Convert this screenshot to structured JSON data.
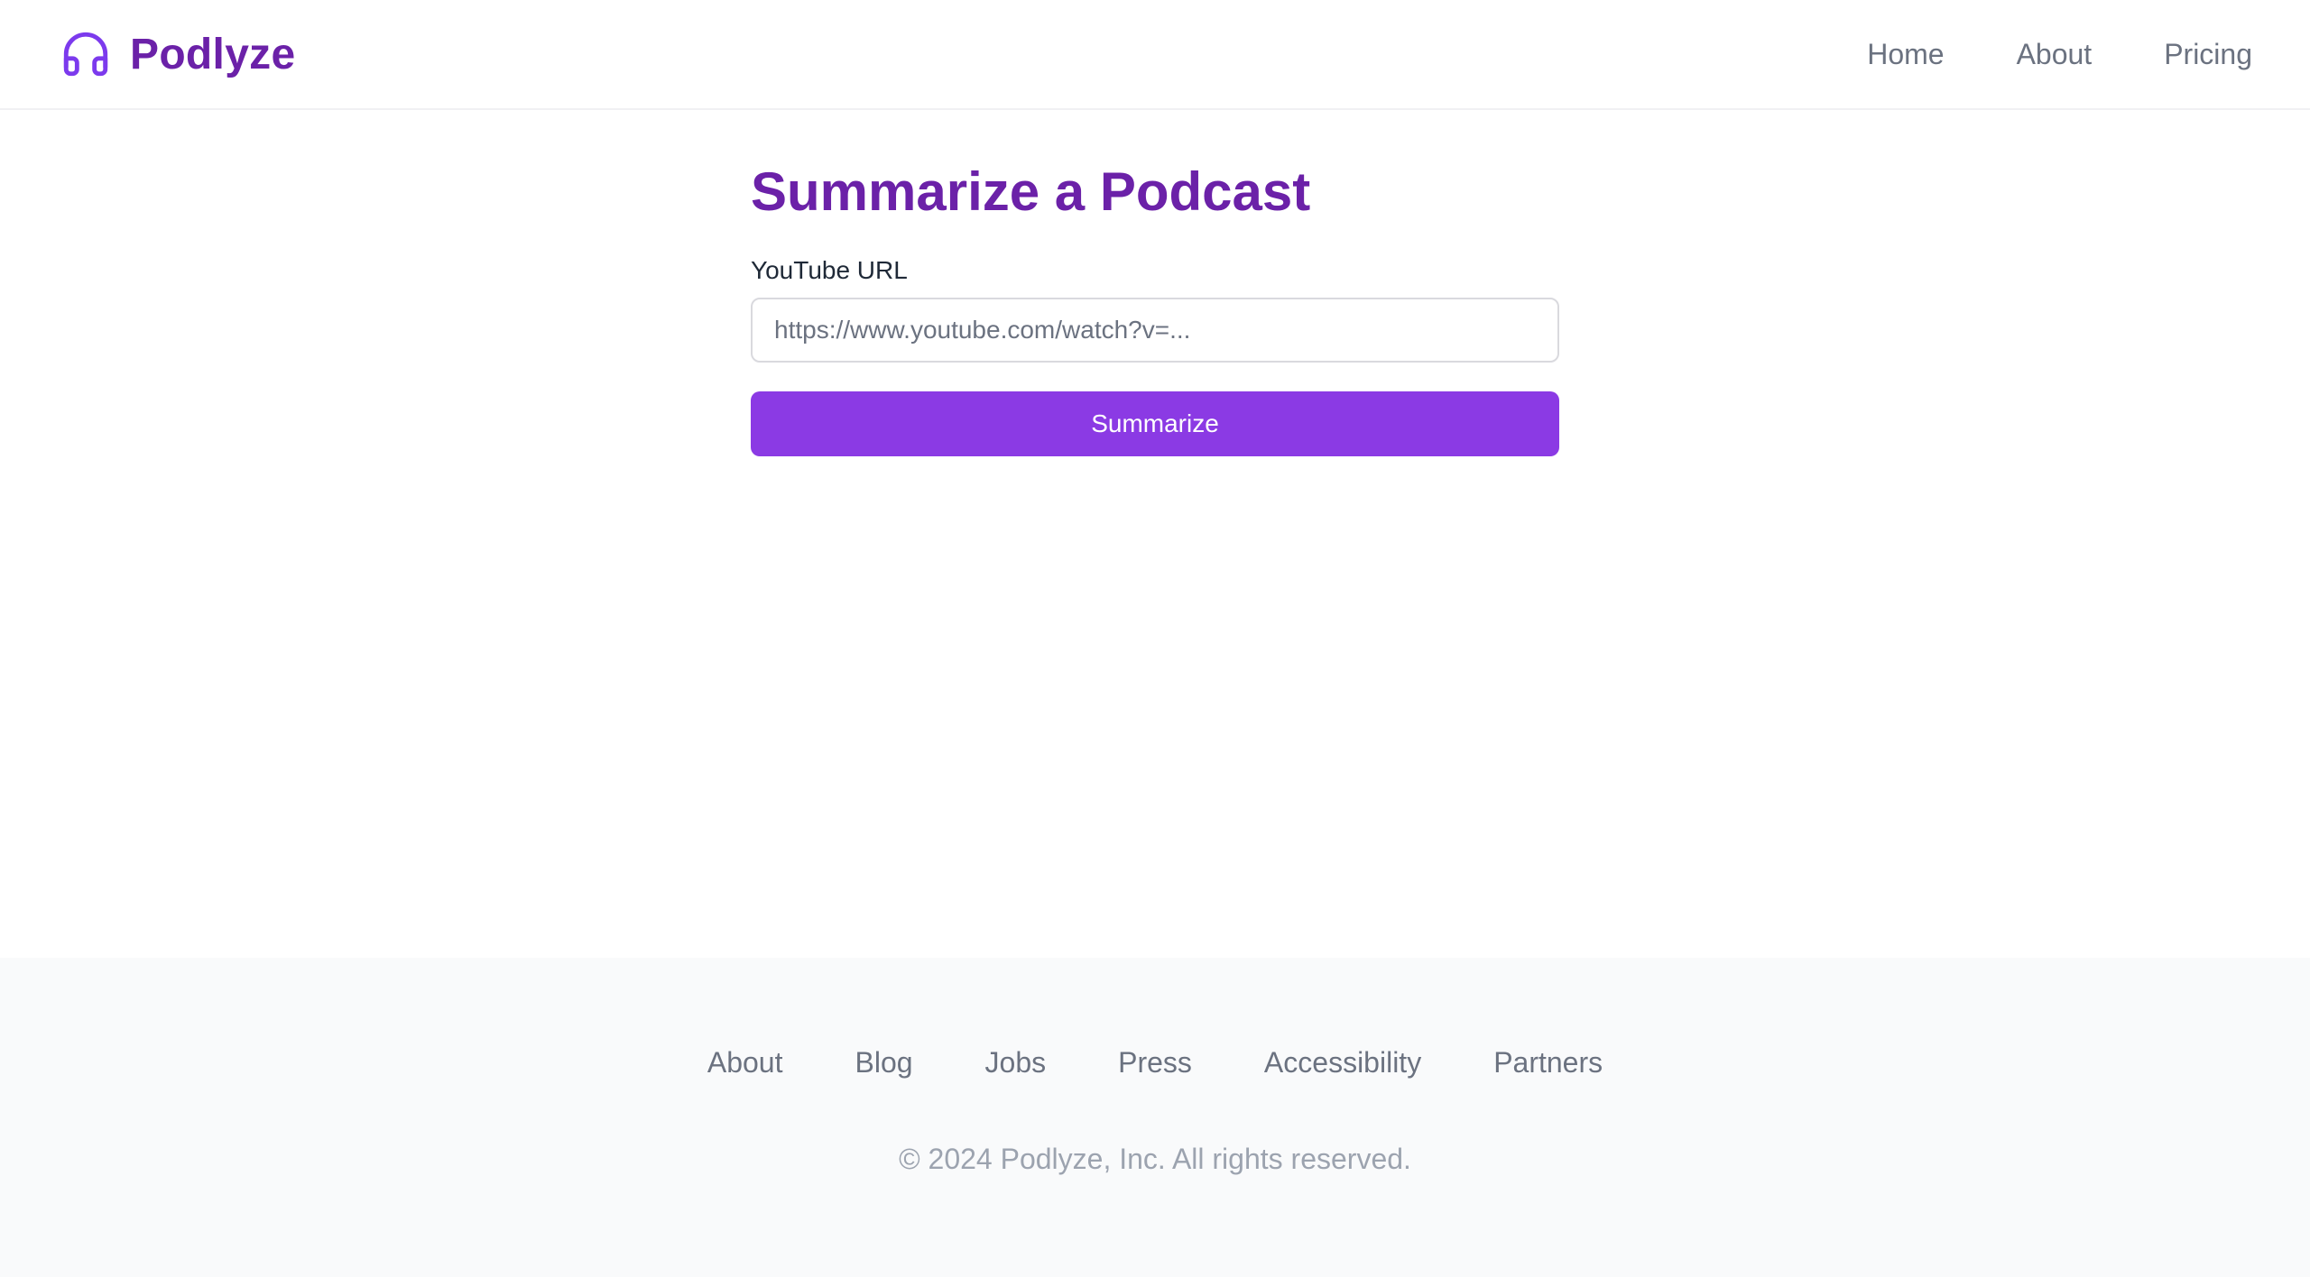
{
  "header": {
    "brand_name": "Podlyze",
    "brand_icon": "headphones-icon",
    "nav": [
      {
        "label": "Home"
      },
      {
        "label": "About"
      },
      {
        "label": "Pricing"
      }
    ]
  },
  "main": {
    "title": "Summarize a Podcast",
    "url_label": "YouTube URL",
    "url_placeholder": "https://www.youtube.com/watch?v=...",
    "url_value": "",
    "submit_label": "Summarize"
  },
  "footer": {
    "links": [
      {
        "label": "About"
      },
      {
        "label": "Blog"
      },
      {
        "label": "Jobs"
      },
      {
        "label": "Press"
      },
      {
        "label": "Accessibility"
      },
      {
        "label": "Partners"
      }
    ],
    "copyright": "© 2024 Podlyze, Inc. All rights reserved."
  },
  "colors": {
    "brand": "#6b21a8",
    "accent": "#8b3ae4",
    "icon": "#7c3aed",
    "nav_text": "#6b7280",
    "footer_bg": "#f9fafb"
  }
}
